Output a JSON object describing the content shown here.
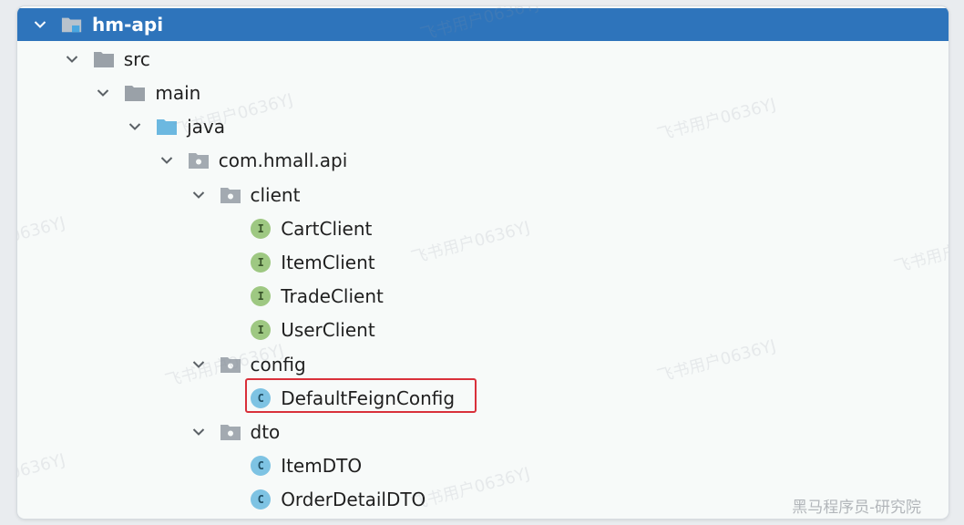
{
  "tree": {
    "rows": [
      {
        "label": "hm-api",
        "depth": 0,
        "arrow": true,
        "icon": "module-folder-icon",
        "selected": true
      },
      {
        "label": "src",
        "depth": 1,
        "arrow": true,
        "icon": "folder-icon"
      },
      {
        "label": "main",
        "depth": 2,
        "arrow": true,
        "icon": "folder-icon"
      },
      {
        "label": "java",
        "depth": 3,
        "arrow": true,
        "icon": "source-folder-icon"
      },
      {
        "label": "com.hmall.api",
        "depth": 4,
        "arrow": true,
        "icon": "package-icon"
      },
      {
        "label": "client",
        "depth": 5,
        "arrow": true,
        "icon": "package-icon"
      },
      {
        "label": "CartClient",
        "depth": 6,
        "arrow": false,
        "icon": "interface-icon",
        "badge": "I"
      },
      {
        "label": "ItemClient",
        "depth": 6,
        "arrow": false,
        "icon": "interface-icon",
        "badge": "I"
      },
      {
        "label": "TradeClient",
        "depth": 6,
        "arrow": false,
        "icon": "interface-icon",
        "badge": "I"
      },
      {
        "label": "UserClient",
        "depth": 6,
        "arrow": false,
        "icon": "interface-icon",
        "badge": "I"
      },
      {
        "label": "config",
        "depth": 5,
        "arrow": true,
        "icon": "package-icon"
      },
      {
        "label": "DefaultFeignConfig",
        "depth": 6,
        "arrow": false,
        "icon": "class-icon",
        "badge": "C",
        "highlighted": true
      },
      {
        "label": "dto",
        "depth": 5,
        "arrow": true,
        "icon": "package-icon"
      },
      {
        "label": "ItemDTO",
        "depth": 6,
        "arrow": false,
        "icon": "class-icon",
        "badge": "C"
      },
      {
        "label": "OrderDetailDTO",
        "depth": 6,
        "arrow": false,
        "icon": "class-icon",
        "badge": "C"
      }
    ]
  },
  "watermarks": {
    "text": "飞书用户0636YJ",
    "corner": "黑马程序员-研究院"
  },
  "colors": {
    "selection": "#2e74bb",
    "highlight_border": "#d9303a",
    "interface_badge": "#9ec882",
    "class_badge": "#7ec3e3",
    "folder": "#9aa1a8",
    "source_folder": "#6cb8e0"
  }
}
